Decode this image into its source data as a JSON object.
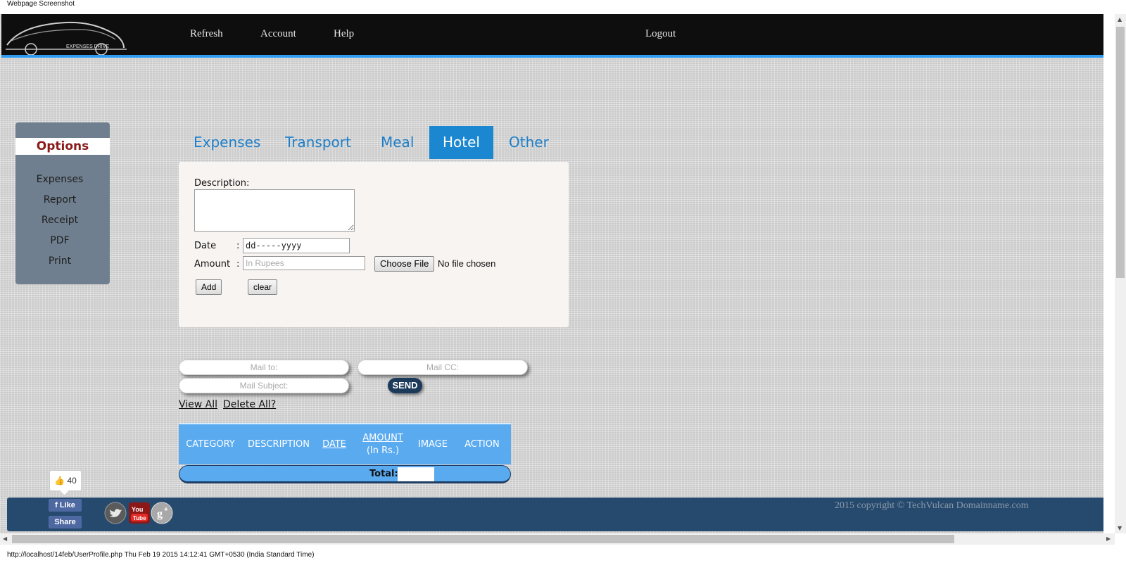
{
  "capture": {
    "title": "Webpage Screenshot",
    "status_line": "http://localhost/14feb/UserProfile.php Thu Feb 19 2015 14:12:41 GMT+0530 (India Standard Time)"
  },
  "header": {
    "logo_text": "EXPENSES DRIVE",
    "nav": [
      "Refresh",
      "Account",
      "Help"
    ],
    "logout": "Logout"
  },
  "sidebar": {
    "title": "Options",
    "items": [
      "Expenses",
      "Report",
      "Receipt",
      "PDF",
      "Print"
    ]
  },
  "tabs": {
    "items": [
      "Expenses",
      "Transport",
      "Meal",
      "Hotel",
      "Other"
    ],
    "active": "Hotel"
  },
  "form": {
    "description_label": "Description:",
    "description_value": "",
    "date_label": "Date",
    "colon": ":",
    "date_placeholder": "dd-----yyyy",
    "amount_label": "Amount",
    "amount_placeholder": "In Rupees",
    "file_button": "Choose File",
    "file_status": "No file chosen",
    "add_button": "Add",
    "clear_button": "clear"
  },
  "mail": {
    "to_placeholder": "Mail to:",
    "cc_placeholder": "Mail CC:",
    "subject_placeholder": "Mail Subject:",
    "send_label": "SEND",
    "view_all": "View All",
    "delete_all": "Delete All?"
  },
  "table": {
    "columns": [
      "CATEGORY",
      "DESCRIPTION",
      "DATE",
      "AMOUNT",
      "IMAGE",
      "ACTION"
    ],
    "amount_sub": "(In Rs.)",
    "total_label": "Total:",
    "total_value": ""
  },
  "social": {
    "like_count": "40",
    "like_label": "Like",
    "share_label": "Share",
    "icons": [
      "twitter-icon",
      "youtube-icon",
      "google-plus-icon"
    ]
  },
  "footer": {
    "copyright": "2015 copyright © TechVulcan Domainname.com"
  },
  "colors": {
    "accent": "#1b87d0",
    "header_bg": "#0e0e0e",
    "footer_bg": "#264a6e",
    "table_bg": "#5aaaf0",
    "options_title": "#8b1a1a"
  }
}
